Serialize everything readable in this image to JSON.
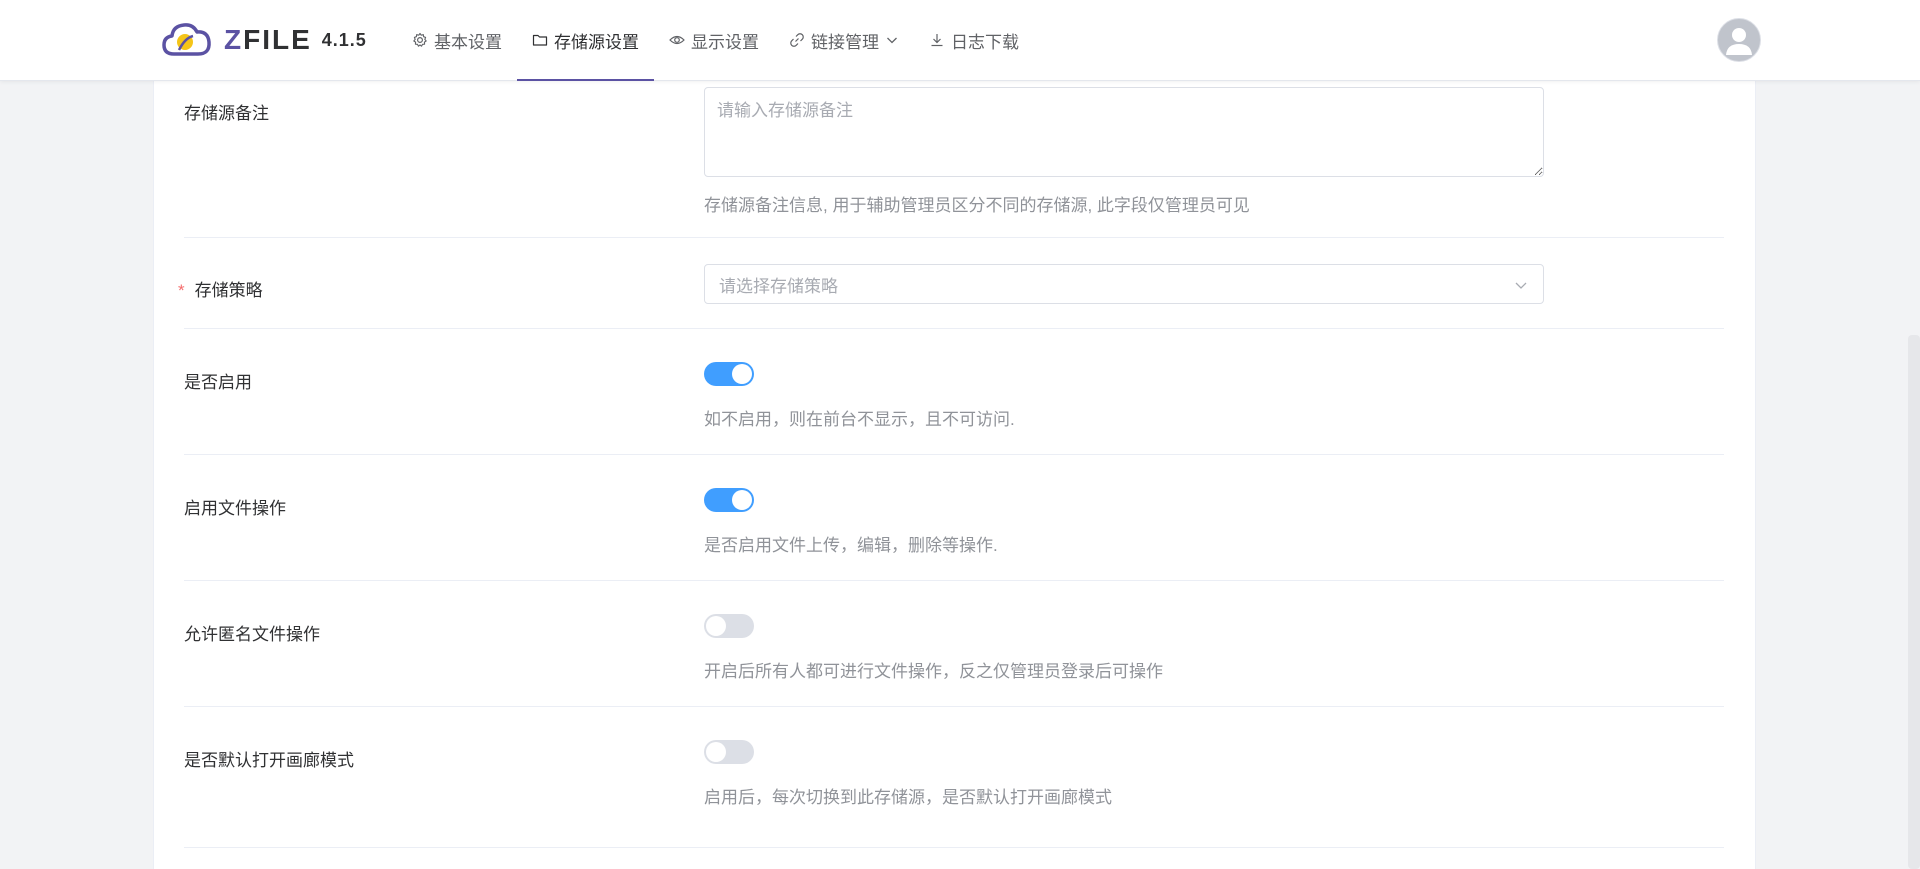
{
  "app": {
    "brand": "ZFILE",
    "version": "4.1.5"
  },
  "nav": [
    {
      "label": "基本设置",
      "icon": "gear-icon"
    },
    {
      "label": "存储源设置",
      "icon": "folder-icon",
      "active": true
    },
    {
      "label": "显示设置",
      "icon": "eye-icon"
    },
    {
      "label": "链接管理",
      "icon": "link-icon",
      "dropdown": true
    },
    {
      "label": "日志下载",
      "icon": "download-icon"
    }
  ],
  "form": {
    "remark": {
      "label": "存储源备注",
      "placeholder": "请输入存储源备注",
      "help": "存储源备注信息, 用于辅助管理员区分不同的存储源, 此字段仅管理员可见"
    },
    "strategy": {
      "label": "存储策略",
      "required": "*",
      "placeholder": "请选择存储策略"
    },
    "enable": {
      "label": "是否启用",
      "on": true,
      "help": "如不启用，则在前台不显示，且不可访问."
    },
    "file_ops": {
      "label": "启用文件操作",
      "on": true,
      "help": "是否启用文件上传，编辑，删除等操作."
    },
    "anonymous": {
      "label": "允许匿名文件操作",
      "on": false,
      "help": "开启后所有人都可进行文件操作，反之仅管理员登录后可操作"
    },
    "gallery": {
      "label": "是否默认打开画廊模式",
      "on": false,
      "help": "启用后，每次切换到此存储源，是否默认打开画廊模式"
    }
  },
  "colors": {
    "accent": "#5b52a3",
    "switch_on": "#409eff",
    "switch_off": "#dcdfe6",
    "required": "#f56c6c"
  }
}
